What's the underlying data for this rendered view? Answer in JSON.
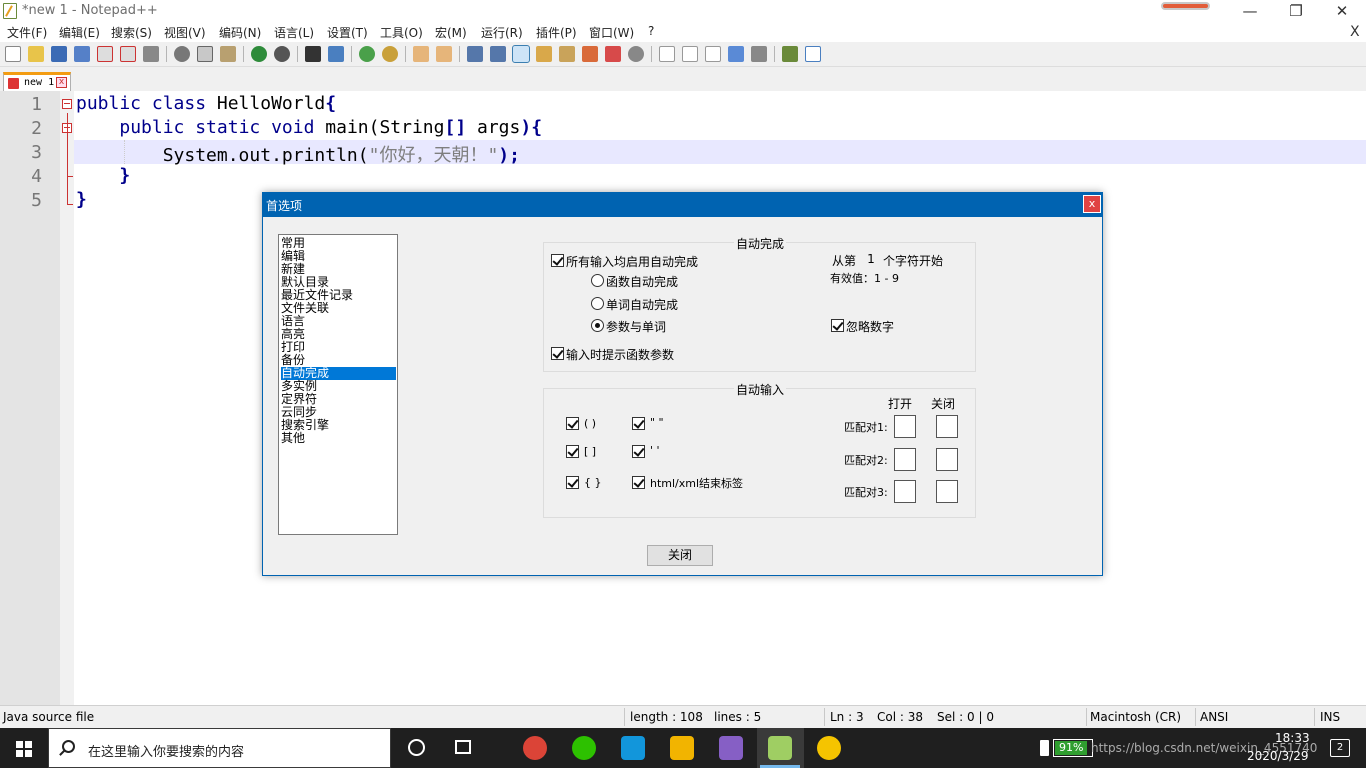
{
  "window": {
    "title": "*new 1 - Notepad++",
    "min": "—",
    "restore": "❐",
    "close": "✕"
  },
  "menu": [
    "文件(F)",
    "编辑(E)",
    "搜索(S)",
    "视图(V)",
    "编码(N)",
    "语言(L)",
    "设置(T)",
    "工具(O)",
    "宏(M)",
    "运行(R)",
    "插件(P)",
    "窗口(W)",
    "?"
  ],
  "menu_close": "X",
  "tab": {
    "label": "new 1",
    "close": "x"
  },
  "line_numbers": [
    "1",
    "2",
    "3",
    "4",
    "5"
  ],
  "code": {
    "l1_kw": "public class",
    "l1_rest": " HelloWorld",
    "l1_brace": "{",
    "l2_indent": "    ",
    "l2_kw": "public static void",
    "l2_rest": " main(String",
    "l2_br": "[]",
    "l2_args": " args",
    "l2_paren": "){",
    "l3_pre": "        System.out.println(",
    "l3_str": "\"你好，天朝！\"",
    "l3_post": ");",
    "l4": "    }",
    "l5": "}"
  },
  "dialog": {
    "title": "首选项",
    "close": "x",
    "categories": [
      "常用",
      "编辑",
      "新建",
      "默认目录",
      "最近文件记录",
      "文件关联",
      "语言",
      "高亮",
      "打印",
      "备份",
      "自动完成",
      "多实例",
      "定界符",
      "云同步",
      "搜索引擎",
      "其他"
    ],
    "selected_category": "自动完成",
    "autocomplete": {
      "title": "自动完成",
      "enable_all": "所有输入均启用自动完成",
      "enable_all_checked": true,
      "from_prefix": "从第",
      "from_value": "1",
      "from_suffix": "个字符开始",
      "valid_range": "有效值：1 - 9",
      "opt_function": "函数自动完成",
      "opt_word": "单词自动完成",
      "opt_both": "参数与单词",
      "selected_option": "参数与单词",
      "ignore_numbers": "忽略数字",
      "ignore_numbers_checked": true,
      "param_hint": "输入时提示函数参数",
      "param_hint_checked": true
    },
    "autoinsert": {
      "title": "自动输入",
      "paren": "( )",
      "bracket": "[ ]",
      "brace": "{ }",
      "dquote": "\" \"",
      "squote": "' '",
      "html_close": "html/xml结束标签",
      "col_open": "打开",
      "col_close": "关闭",
      "match1": "匹配对1:",
      "match2": "匹配对2:",
      "match3": "匹配对3:"
    },
    "close_button": "关闭"
  },
  "status": {
    "filetype": "Java source file",
    "length": "length : 108",
    "lines": "lines : 5",
    "ln": "Ln : 3",
    "col": "Col : 38",
    "sel": "Sel : 0 | 0",
    "eol": "Macintosh (CR)",
    "encoding": "ANSI",
    "mode": "INS"
  },
  "taskbar": {
    "search_placeholder": "在这里输入你要搜索的内容",
    "battery": "91%",
    "tray_text": "https://blog.csdn.net/weixin_4551740",
    "time": "18:33",
    "date": "2020/3/29",
    "notifications": "2"
  },
  "colors": {
    "accent": "#0063b1",
    "selection": "#0078d7",
    "keyword": "#00008b",
    "string": "#7f7f7f",
    "current_line": "#e8e8ff"
  }
}
